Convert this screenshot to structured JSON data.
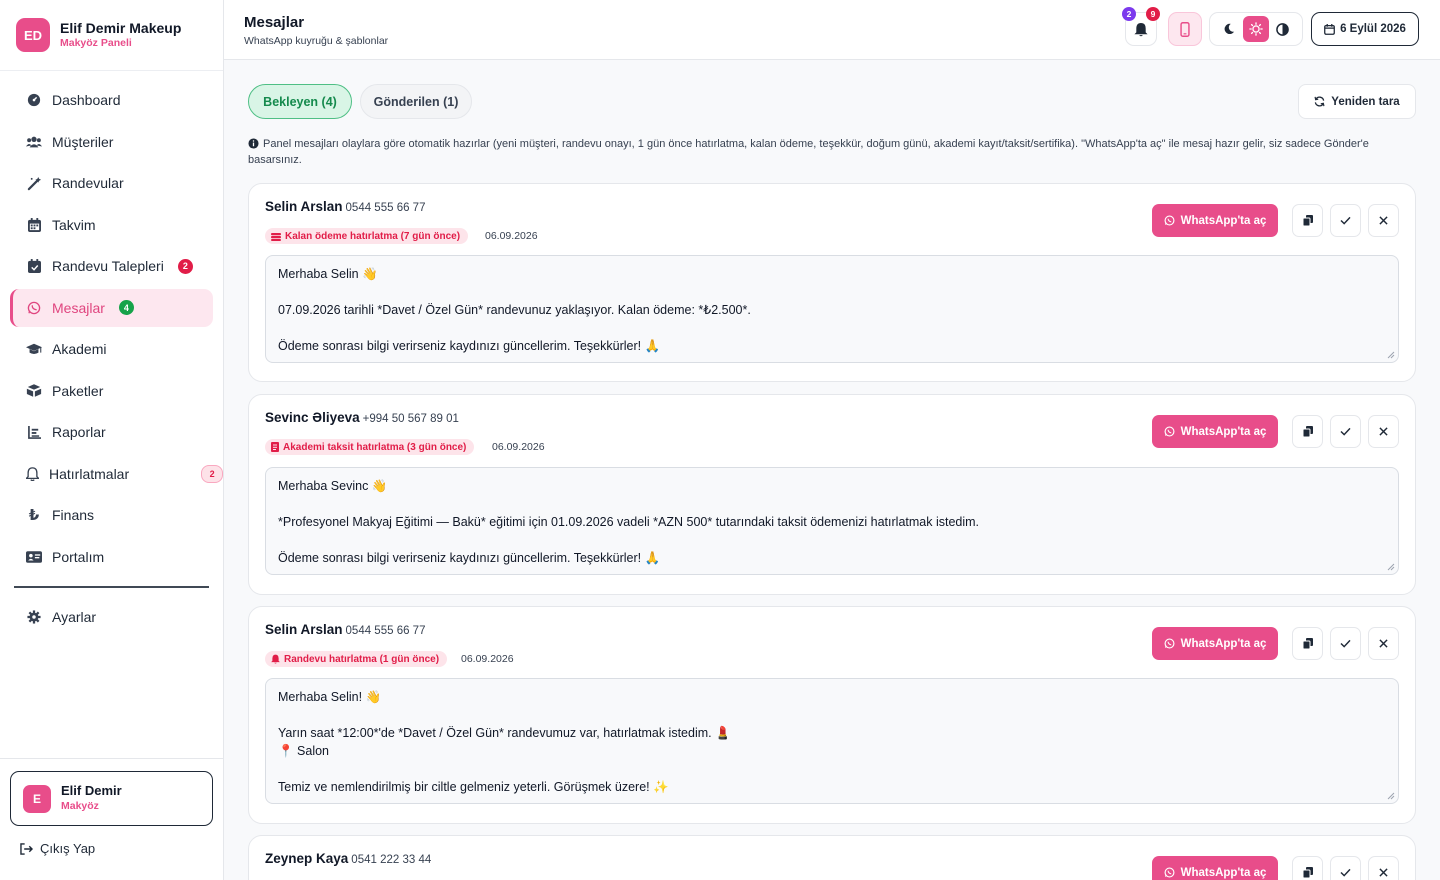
{
  "brand": {
    "logo": "ED",
    "name": "Elif Demir Makeup",
    "sub": "Makyöz Paneli"
  },
  "nav": [
    {
      "label": "Dashboard",
      "icon": "dashboard-icon"
    },
    {
      "label": "Müşteriler",
      "icon": "users-icon"
    },
    {
      "label": "Randevular",
      "icon": "magic-wand-icon"
    },
    {
      "label": "Takvim",
      "icon": "calendar-icon"
    },
    {
      "label": "Randevu Talepleri",
      "icon": "calendar-check-icon",
      "badge": "2"
    },
    {
      "label": "Mesajlar",
      "icon": "whatsapp-icon",
      "badge": "4"
    },
    {
      "label": "Akademi",
      "icon": "graduation-cap-icon"
    },
    {
      "label": "Paketler",
      "icon": "box-icon"
    },
    {
      "label": "Raporlar",
      "icon": "chart-icon"
    },
    {
      "label": "Hatırlatmalar",
      "icon": "bell-icon",
      "badge": "2"
    },
    {
      "label": "Finans",
      "icon": "lira-icon"
    },
    {
      "label": "Portalım",
      "icon": "id-card-icon"
    },
    {
      "label": "Ayarlar",
      "icon": "gear-icon"
    }
  ],
  "user": {
    "initial": "E",
    "name": "Elif Demir",
    "role": "Makyöz"
  },
  "logout": "Çıkış Yap",
  "header": {
    "title": "Mesajlar",
    "subtitle": "WhatsApp kuyruğu & şablonlar",
    "notif_badge_1": "2",
    "notif_badge_2": "9",
    "date": "6 Eylül 2026"
  },
  "tabs": {
    "pending": "Bekleyen (4)",
    "sent": "Gönderilen (1)"
  },
  "rescan": "Yeniden tara",
  "info": "Panel mesajları olaylara göre otomatik hazırlar (yeni müşteri, randevu onayı, 1 gün önce hatırlatma, kalan ödeme, teşekkür, doğum günü, akademi kayıt/taksit/sertifika). \"WhatsApp'ta aç\" ile mesaj hazır gelir, siz sadece Gönder'e basarsınız.",
  "wa_label": "WhatsApp'ta aç",
  "colors": {
    "accent": "#e84d8a",
    "success": "#16a34a",
    "danger": "#e11d48"
  },
  "messages": [
    {
      "name": "Selin Arslan",
      "phone": "0544 555 66 77",
      "tag": "Kalan ödeme hatırlatma (7 gün önce)",
      "tag_icon": "money-icon",
      "date": "06.09.2026",
      "text": "Merhaba Selin 👋\n\n07.09.2026 tarihli *Davet / Özel Gün* randevunuz yaklaşıyor. Kalan ödeme: *₺2.500*.\n\nÖdeme sonrası bilgi verirseniz kaydınızı güncellerim. Teşekkürler! 🙏"
    },
    {
      "name": "Sevinc Əliyeva",
      "phone": "+994 50 567 89 01",
      "tag": "Akademi taksit hatırlatma (3 gün önce)",
      "tag_icon": "receipt-icon",
      "date": "06.09.2026",
      "text": "Merhaba Sevinc 👋\n\n*Profesyonel Makyaj Eğitimi — Bakü* eğitimi için 01.09.2026 vadeli *AZN 500* tutarındaki taksit ödemenizi hatırlatmak istedim.\n\nÖdeme sonrası bilgi verirseniz kaydınızı güncellerim. Teşekkürler! 🙏"
    },
    {
      "name": "Selin Arslan",
      "phone": "0544 555 66 77",
      "tag": "Randevu hatırlatma (1 gün önce)",
      "tag_icon": "bell-icon",
      "date": "06.09.2026",
      "text": "Merhaba Selin! 👋\n\nYarın saat *12:00*'de *Davet / Özel Gün* randevumuz var, hatırlatmak istedim. 💄\n📍 Salon\n\nTemiz ve nemlendirilmiş bir ciltle gelmeniz yeterli. Görüşmek üzere! ✨"
    },
    {
      "name": "Zeynep Kaya",
      "phone": "0541 222 33 44",
      "tag": "",
      "date": "",
      "text": ""
    }
  ]
}
